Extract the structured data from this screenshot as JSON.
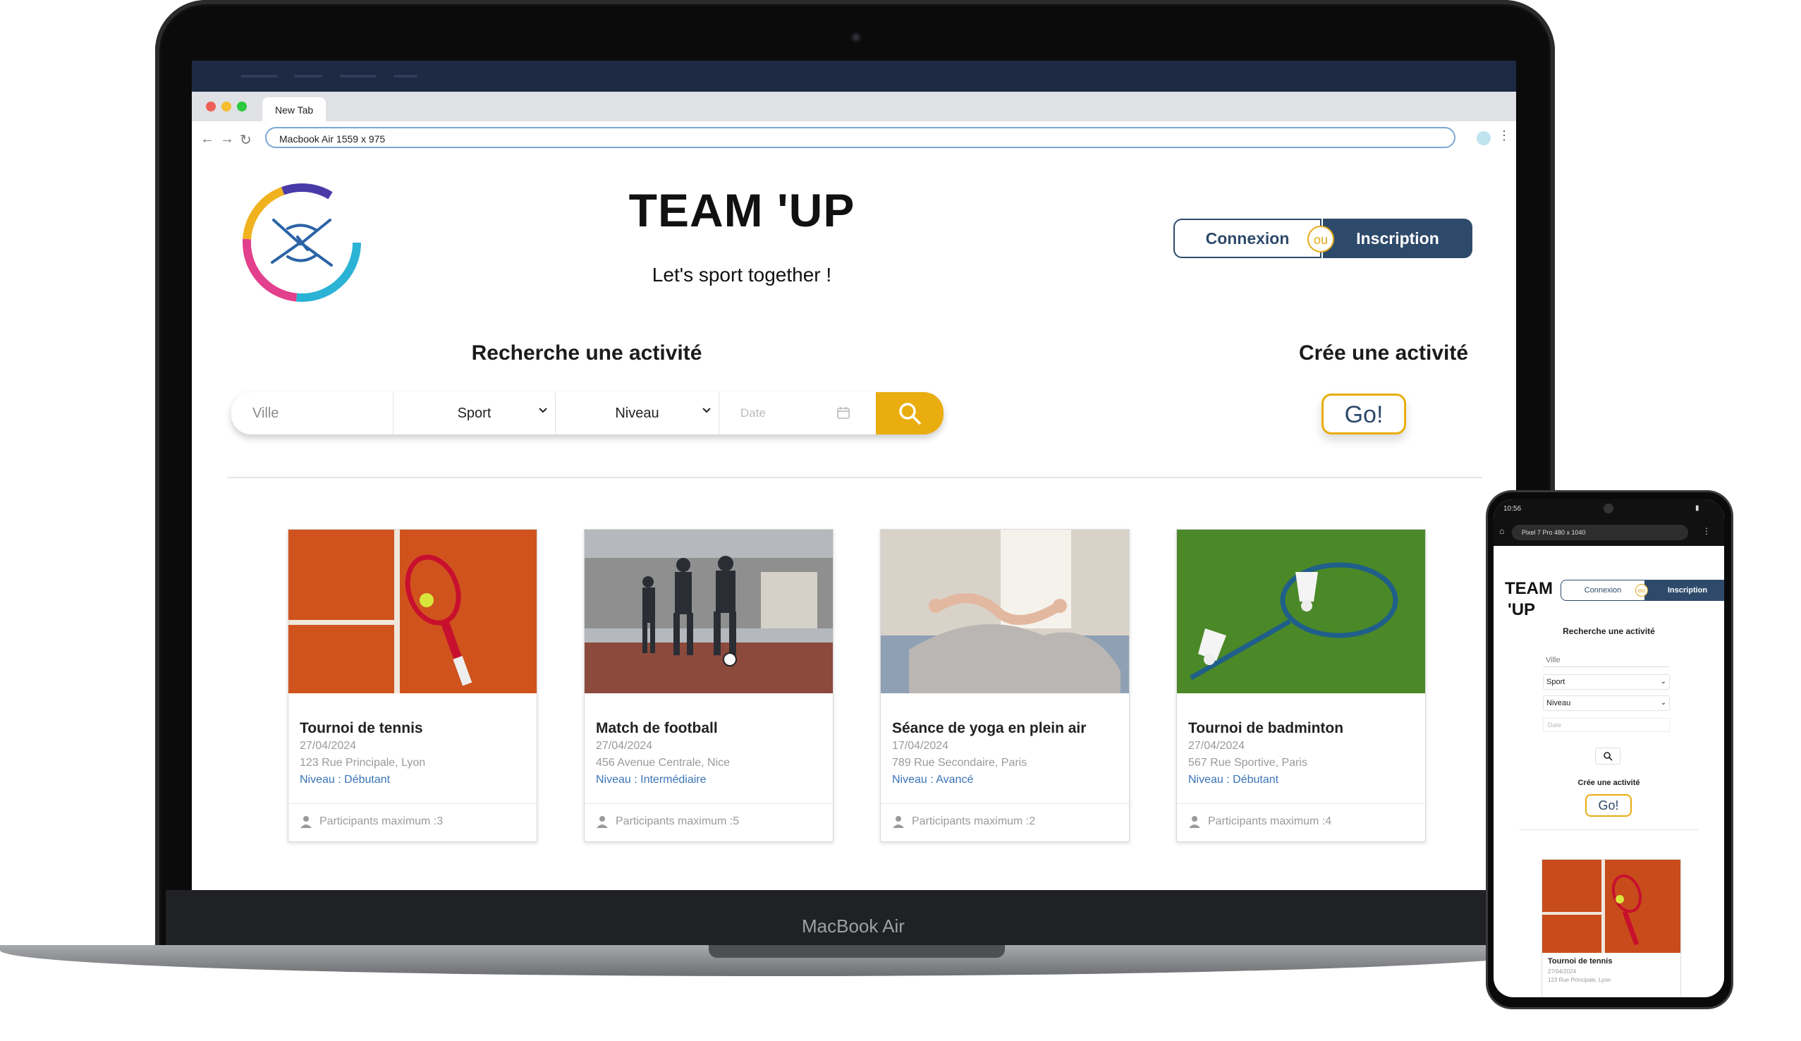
{
  "browser": {
    "tab_title": "New Tab",
    "address": "Macbook Air   1559 x 975"
  },
  "header": {
    "brand": "TEAM 'UP",
    "tagline": "Let's sport together !",
    "login_label": "Connexion",
    "or_label": "ou",
    "signup_label": "Inscription"
  },
  "search": {
    "title": "Recherche une activité",
    "city_placeholder": "Ville",
    "sport_selected": "Sport",
    "level_selected": "Niveau",
    "date_placeholder": "Date"
  },
  "create": {
    "title": "Crée une activité",
    "go_label": "Go!"
  },
  "cards": [
    {
      "title": "Tournoi de tennis",
      "date": "27/04/2024",
      "address": "123 Rue Principale, Lyon",
      "level": "Niveau : Débutant",
      "participants": "Participants maximum :3"
    },
    {
      "title": "Match de football",
      "date": "27/04/2024",
      "address": "456 Avenue Centrale, Nice",
      "level": "Niveau : Intermédiaire",
      "participants": "Participants maximum :5"
    },
    {
      "title": "Séance de yoga en plein air",
      "date": "17/04/2024",
      "address": "789 Rue Secondaire, Paris",
      "level": "Niveau : Avancé",
      "participants": "Participants maximum :2"
    },
    {
      "title": "Tournoi de badminton",
      "date": "27/04/2024",
      "address": "567 Rue Sportive, Paris",
      "level": "Niveau : Débutant",
      "participants": "Participants maximum :4"
    }
  ],
  "device": {
    "laptop_label": "MacBook Air"
  },
  "phone": {
    "status_time": "10:56",
    "address": "Pixel 7 Pro  480 x 1040",
    "brand_line1": "TEAM",
    "brand_line2": "'UP",
    "login_label": "Connexion",
    "or_label": "ou",
    "signup_label": "Inscription",
    "search_title": "Recherche une activité",
    "city_placeholder": "Ville",
    "sport_selected": "Sport",
    "level_selected": "Niveau",
    "date_placeholder": "Date",
    "create_title": "Crée une activité",
    "go_label": "Go!",
    "card_title": "Tournoi de tennis",
    "card_date": "27/04/2024",
    "card_address": "123 Rue Principale, Lyon"
  },
  "colors": {
    "navy": "#2e4a6b",
    "accent_yellow": "#e9ad0f",
    "link_blue": "#3a74b8"
  }
}
